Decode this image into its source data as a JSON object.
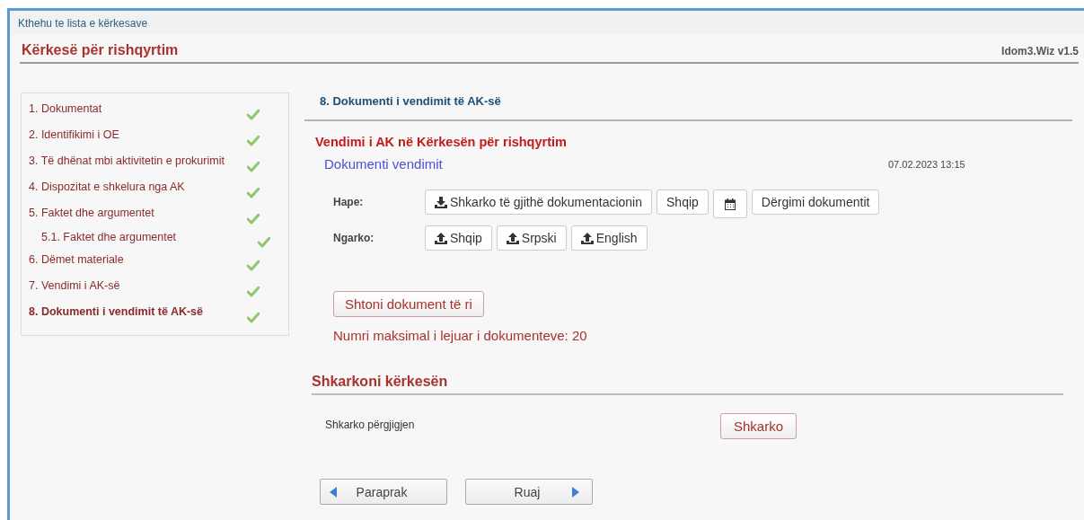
{
  "back_link": "Kthehu te lista e kërkesave",
  "page_title": "Kërkesë për rishqyrtim",
  "version": "Idom3.Wiz v1.5",
  "steps": [
    {
      "label": "1. Dokumentat",
      "completed": true,
      "selected": false
    },
    {
      "label": "2. Identifikimi i OE",
      "completed": true,
      "selected": false
    },
    {
      "label": "3. Të dhënat mbi aktivitetin e prokurimit",
      "completed": true,
      "selected": false
    },
    {
      "label": "4. Dispozitat e shkelura nga AK",
      "completed": true,
      "selected": false
    },
    {
      "label": "5. Faktet dhe argumentet",
      "completed": true,
      "selected": false,
      "children": [
        {
          "label": "5.1. Faktet dhe argumentet",
          "completed": true,
          "selected": false
        }
      ]
    },
    {
      "label": "6. Dëmet materiale",
      "completed": true,
      "selected": false
    },
    {
      "label": "7. Vendimi i AK-së",
      "completed": true,
      "selected": false
    },
    {
      "label": "8. Dokumenti i vendimit të AK-së",
      "completed": true,
      "selected": true
    }
  ],
  "section_title": "8. Dokumenti i vendimit të AK-së",
  "decision": {
    "heading": "Vendimi i AK në Kërkesën për rishqyrtim",
    "document_name": "Dokumenti vendimit",
    "timestamp": "07.02.2023 13:15",
    "rows": [
      {
        "label": "Hape:",
        "buttons": [
          {
            "label": "Shkarko të gjithë dokumentacionin",
            "kind": "download"
          },
          {
            "label": "Shqip",
            "kind": "text"
          },
          {
            "kind": "calendar"
          },
          {
            "label": "Dërgimi dokumentit",
            "kind": "text"
          }
        ]
      },
      {
        "label": "Ngarko:",
        "buttons": [
          {
            "label": "Shqip",
            "kind": "upload"
          },
          {
            "label": "Srpski",
            "kind": "upload"
          },
          {
            "label": "English",
            "kind": "upload"
          }
        ]
      }
    ]
  },
  "add_button": "Shtoni dokument të ri",
  "limit_note": "Numri maksimal i lejuar i dokumenteve: 20",
  "download_section": {
    "title": "Shkarkoni kërkesën",
    "label": "Shkarko përgjigjen",
    "button": "Shkarko"
  },
  "nav": [
    {
      "label": "Paraprak",
      "kind": "prev"
    },
    {
      "label": "Ruaj",
      "kind": "next"
    }
  ]
}
